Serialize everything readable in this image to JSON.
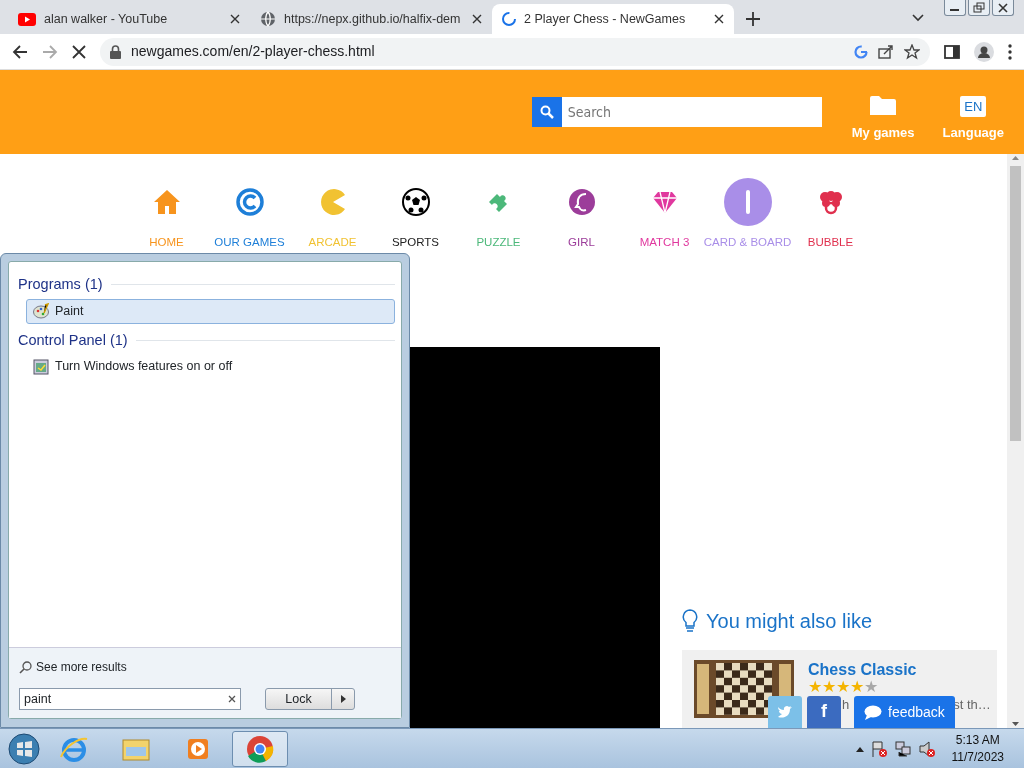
{
  "browser": {
    "tabs": [
      {
        "title": "alan walker - YouTube",
        "selected": false
      },
      {
        "title": "https://nepx.github.io/halfix-dem",
        "selected": false
      },
      {
        "title": "2 Player Chess - NewGames",
        "selected": true
      }
    ],
    "url": "newgames.com/en/2-player-chess.html"
  },
  "site": {
    "search": {
      "placeholder": "Search"
    },
    "header_links": [
      "My games",
      "Language"
    ],
    "language_badge": "EN",
    "categories": [
      {
        "label": "HOME",
        "color": "#f7941d",
        "selected": false
      },
      {
        "label": "OUR GAMES",
        "color": "#1e7fd8",
        "selected": false
      },
      {
        "label": "ARCADE",
        "color": "#f1c232",
        "selected": false
      },
      {
        "label": "SPORTS",
        "color": "#222222",
        "selected": false
      },
      {
        "label": "PUZZLE",
        "color": "#4cb87a",
        "selected": false
      },
      {
        "label": "GIRL",
        "color": "#9c3d9a",
        "selected": false
      },
      {
        "label": "MATCH 3",
        "color": "#e0389e",
        "selected": false
      },
      {
        "label": "CARD & BOARD",
        "color": "#a98ee8",
        "selected": true
      },
      {
        "label": "BUBBLE",
        "color": "#e0304e",
        "selected": false
      }
    ],
    "related": {
      "heading": "You might also like",
      "game": {
        "title": "Chess Classic",
        "stars": 4,
        "description_parts": [
          "h",
          "st th…"
        ]
      }
    },
    "share_buttons": {
      "facebook": "f"
    },
    "feedback": "feedback"
  },
  "start_menu": {
    "groups": [
      {
        "title": "Programs (1)",
        "items": [
          {
            "label": "Paint",
            "selected": true
          }
        ]
      },
      {
        "title": "Control Panel (1)",
        "items": [
          {
            "label": "Turn Windows features on or off",
            "selected": false
          }
        ]
      }
    ],
    "see_more": "See more results",
    "search_value": "paint",
    "lock_button": "Lock"
  },
  "taskbar": {
    "apps": [
      {
        "active": false
      },
      {
        "active": false
      },
      {
        "active": false
      },
      {
        "active": true
      }
    ],
    "time": "5:13 AM",
    "date": "11/7/2023"
  }
}
